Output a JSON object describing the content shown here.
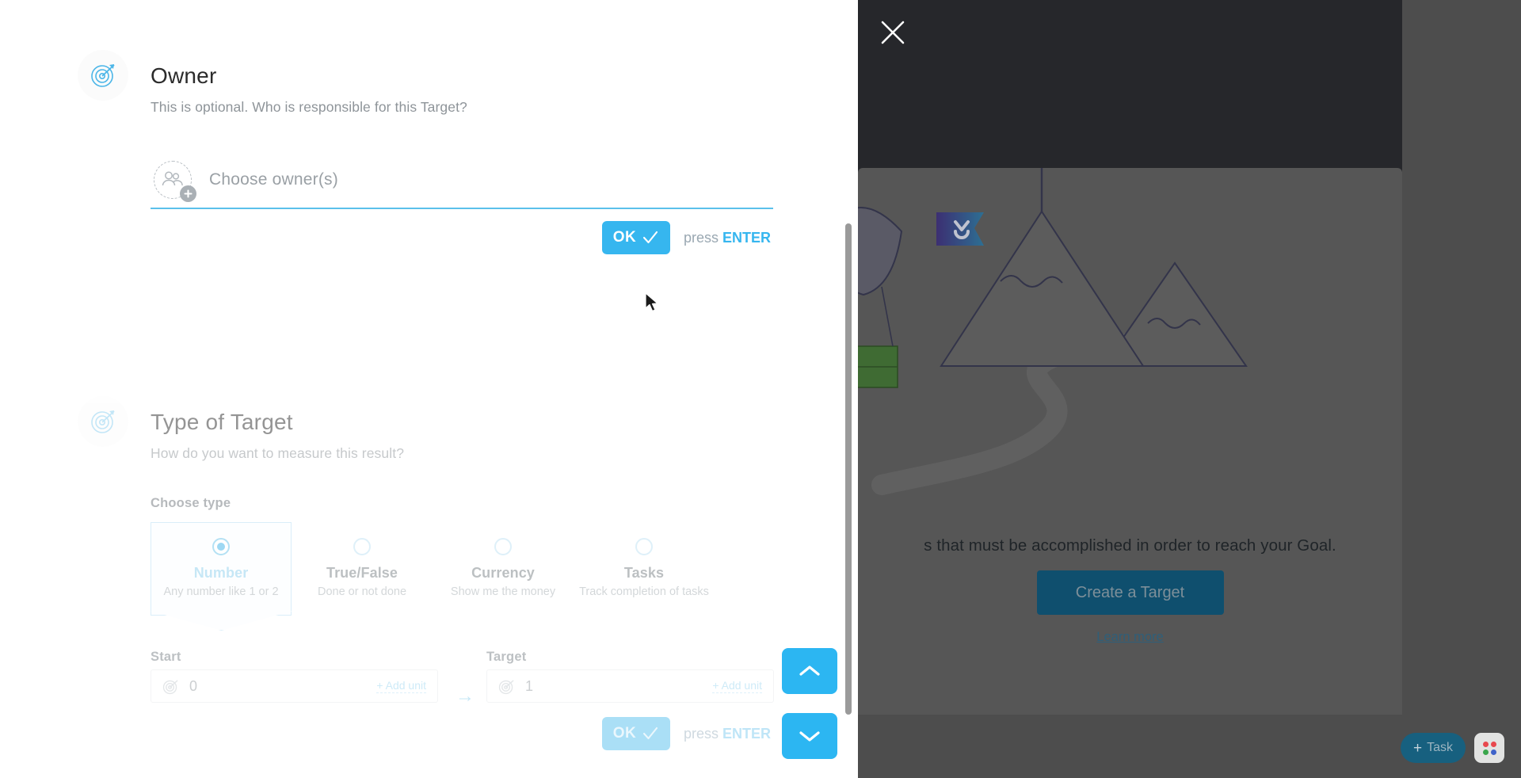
{
  "panel": {
    "owner_section": {
      "icon": "target-icon",
      "title": "Owner",
      "subtitle": "This is optional. Who is responsible for this Target?",
      "input": {
        "placeholder": "Choose owner(s)",
        "value": "",
        "avatar_icon": "add-people-icon"
      },
      "ok_label": "OK",
      "ok_hint_prefix": "press ",
      "ok_hint_key": "ENTER"
    },
    "type_section": {
      "icon": "target-icon",
      "title": "Type of Target",
      "subtitle": "How do you want to measure this result?",
      "choose_type_label": "Choose type",
      "options": [
        {
          "name": "Number",
          "desc": "Any number like 1 or 2",
          "selected": true
        },
        {
          "name": "True/False",
          "desc": "Done or not done",
          "selected": false
        },
        {
          "name": "Currency",
          "desc": "Show me the money",
          "selected": false
        },
        {
          "name": "Tasks",
          "desc": "Track completion of tasks",
          "selected": false
        }
      ],
      "start": {
        "label": "Start",
        "value": "0",
        "add_unit": "+ Add unit"
      },
      "target": {
        "label": "Target",
        "value": "1",
        "add_unit": "+ Add unit"
      },
      "arrow": "→",
      "ok_label": "OK",
      "ok_hint_prefix": "press ",
      "ok_hint_key": "ENTER"
    },
    "nav": {
      "up_icon": "chevron-up-icon",
      "down_icon": "chevron-down-icon"
    }
  },
  "app": {
    "close_icon": "close-icon",
    "empty_state": {
      "illustration": "mountain-flag-illustration",
      "description": "s that must be accomplished in order to reach your Goal.",
      "primary_button": "Create a Target",
      "learn_more": "Learn more"
    },
    "footer": {
      "task_button": "Task",
      "task_plus": "+",
      "apps_icon": "apps-grid-icon"
    }
  },
  "colors": {
    "accent_blue": "#36b6ef",
    "nav_blue": "#2cb6f2",
    "dark_sheet": "#26272b",
    "backdrop": "#4d4d4d",
    "card": "#565656",
    "primary_btn": "#0f4f6e",
    "task_btn": "#17607f"
  }
}
